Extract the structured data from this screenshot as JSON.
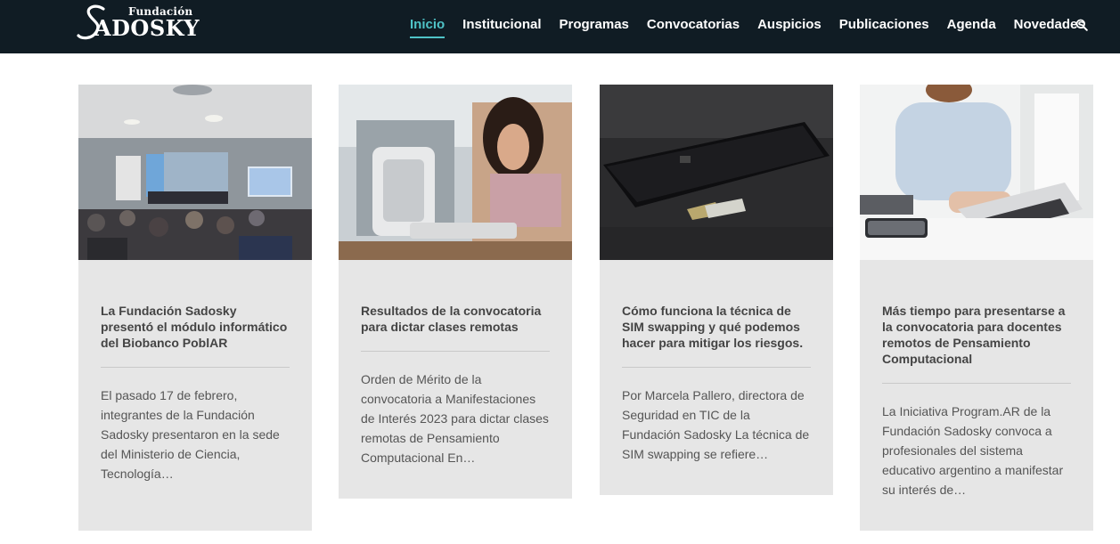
{
  "header": {
    "logo_small": "Fundación",
    "logo_big": "ADOSKY",
    "nav": [
      "Inicio",
      "Institucional",
      "Programas",
      "Convocatorias",
      "Auspicios",
      "Publicaciones",
      "Agenda",
      "Novedades"
    ],
    "active_nav": "Inicio",
    "search_icon": "search-icon",
    "accent_color": "#4fc3c7",
    "background_color": "#101c24"
  },
  "cards": [
    {
      "title": "La Fundación Sadosky presentó el módulo informático del Biobanco PoblAR",
      "excerpt": "El pasado 17 de febrero, integrantes de la Fundación Sadosky presentaron en la sede del Ministerio de Ciencia, Tecnología…"
    },
    {
      "title": "Resultados de la convocatoria para dictar clases remotas",
      "excerpt": "Orden de Mérito de la convocatoria a Manifestaciones de Interés 2023 para dictar clases remotas de Pensamiento Computacional En…"
    },
    {
      "title": "Cómo funciona la técnica de SIM swapping y qué podemos hacer para mitigar los riesgos.",
      "excerpt": "Por Marcela Pallero, directora de Seguridad en TIC de la Fundación Sadosky La técnica de SIM swapping se refiere…"
    },
    {
      "title": "Más tiempo para presentarse a la convocatoria para docentes remotos de Pensamiento Computacional",
      "excerpt": "La Iniciativa Program.AR de la Fundación Sadosky convoca a profesionales del sistema educativo argentino a manifestar su interés de…"
    }
  ]
}
